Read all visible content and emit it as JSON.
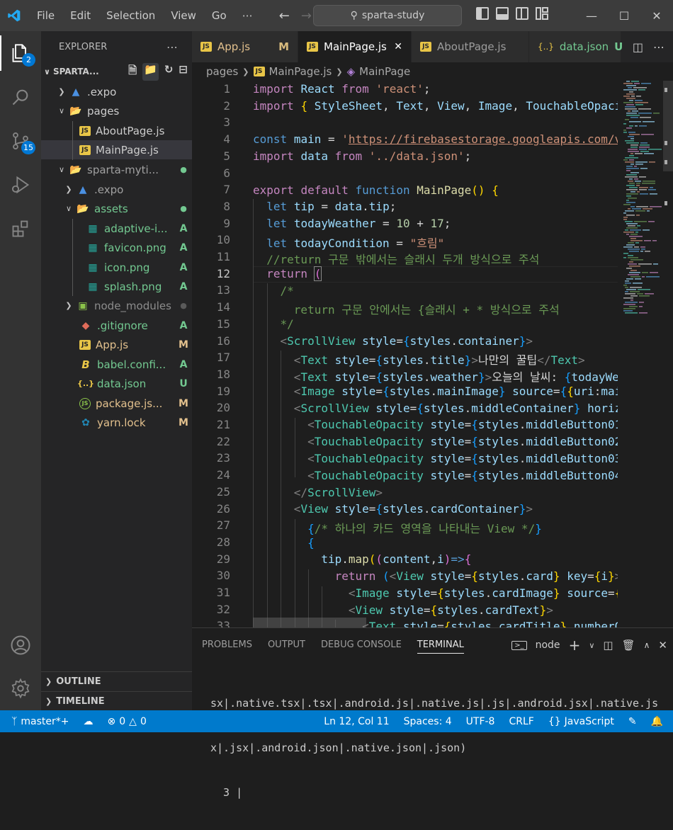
{
  "titlebar": {
    "menu": [
      "File",
      "Edit",
      "Selection",
      "View",
      "Go",
      "⋯"
    ],
    "search": "sparta-study"
  },
  "activity": {
    "explorer_badge": "2",
    "scm_badge": "15"
  },
  "sidebar": {
    "title": "EXPLORER",
    "more": "⋯",
    "project": "SPARTA...",
    "items": [
      {
        "name": ".expo",
        "status": ""
      },
      {
        "name": "pages",
        "status": ""
      },
      {
        "name": "AboutPage.js",
        "status": ""
      },
      {
        "name": "MainPage.js",
        "status": ""
      },
      {
        "name": "sparta-myti...",
        "status": "●"
      },
      {
        "name": ".expo",
        "status": ""
      },
      {
        "name": "assets",
        "status": "●"
      },
      {
        "name": "adaptive-i...",
        "status": "A"
      },
      {
        "name": "favicon.png",
        "status": "A"
      },
      {
        "name": "icon.png",
        "status": "A"
      },
      {
        "name": "splash.png",
        "status": "A"
      },
      {
        "name": "node_modules",
        "status": "●"
      },
      {
        "name": ".gitignore",
        "status": "A"
      },
      {
        "name": "App.js",
        "status": "M"
      },
      {
        "name": "babel.confi...",
        "status": "A"
      },
      {
        "name": "data.json",
        "status": "U"
      },
      {
        "name": "package.js...",
        "status": "M"
      },
      {
        "name": "yarn.lock",
        "status": "M"
      }
    ],
    "outline": "OUTLINE",
    "timeline": "TIMELINE"
  },
  "tabs": [
    {
      "label": "App.js",
      "status": "M",
      "active": false
    },
    {
      "label": "MainPage.js",
      "status": "✕",
      "active": true
    },
    {
      "label": "AboutPage.js",
      "status": "",
      "active": false
    },
    {
      "label": "data.json",
      "status": "U",
      "active": false
    }
  ],
  "breadcrumb": {
    "folder": "pages",
    "file": "MainPage.js",
    "symbol": "MainPage"
  },
  "editor": {
    "current_line": 12,
    "line_numbers": [
      "1",
      "2",
      "3",
      "4",
      "5",
      "6",
      "7",
      "8",
      "9",
      "10",
      "11",
      "12",
      "13",
      "14",
      "15",
      "16",
      "17",
      "18",
      "19",
      "20",
      "21",
      "22",
      "23",
      "24",
      "25",
      "26",
      "27",
      "28",
      "29",
      "30",
      "31",
      "32",
      "33"
    ]
  },
  "panel": {
    "tabs": [
      "PROBLEMS",
      "OUTPUT",
      "DEBUG CONSOLE",
      "TERMINAL"
    ],
    "active_tab": "TERMINAL",
    "terminal_name": "node",
    "terminal_lines": [
      "sx|.native.tsx|.tsx|.android.js|.native.js|.js|.android.jsx|.native.js",
      "x|.jsx|.android.json|.native.json|.json)",
      "  3 |"
    ]
  },
  "statusbar": {
    "branch": "master*+",
    "errors": "0",
    "warnings": "0",
    "position": "Ln 12, Col 11",
    "spaces": "Spaces: 4",
    "encoding": "UTF-8",
    "eol": "CRLF",
    "language": "JavaScript"
  },
  "colors": {
    "statusbar": "#007acc",
    "accent_badge": "#0078d4",
    "editor_bg": "#1e1e1e",
    "sidebar_bg": "#252526"
  }
}
